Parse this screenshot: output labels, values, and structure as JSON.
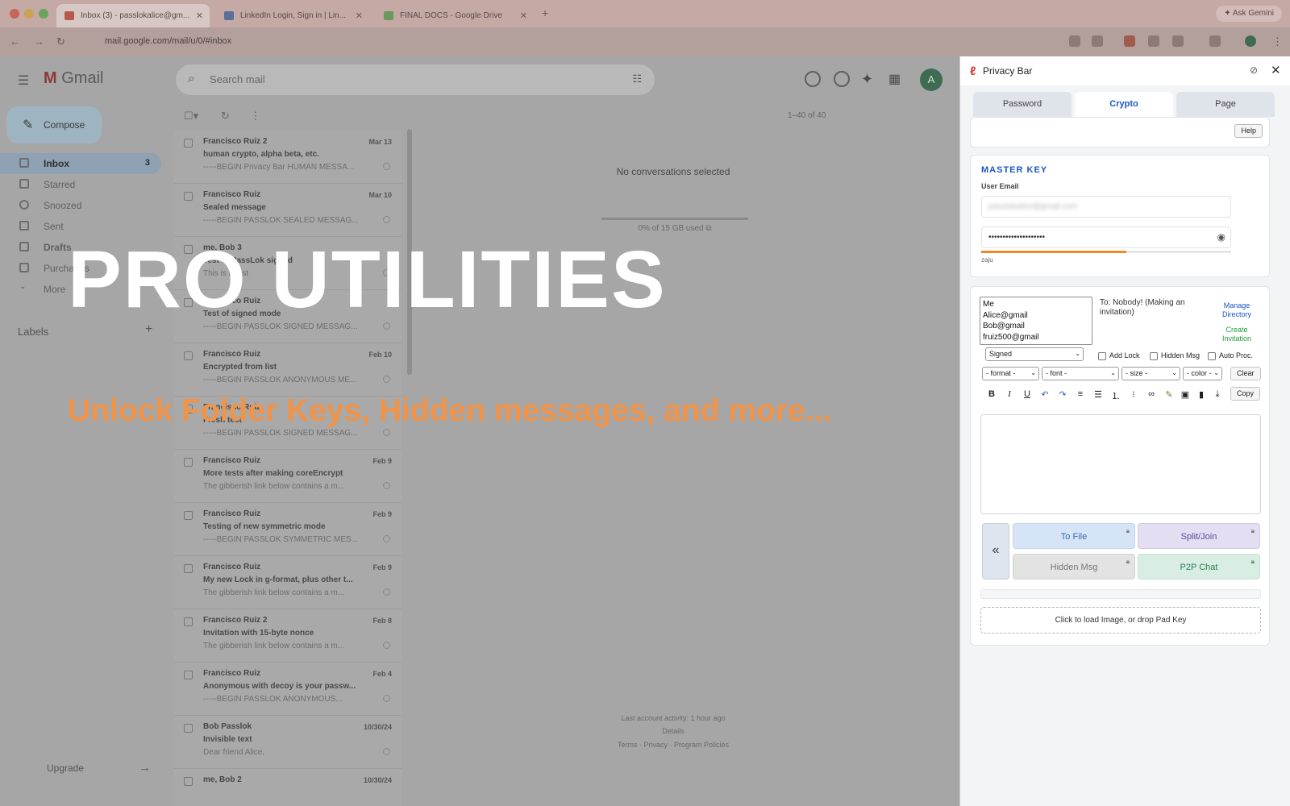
{
  "browser": {
    "tabs": [
      {
        "label": "Inbox (3) - passlokalice@gm...",
        "active": true,
        "favicon_color": "#b55a4a"
      },
      {
        "label": "LinkedIn Login, Sign in | Lin...",
        "active": false,
        "favicon_color": "#5a6f9a"
      },
      {
        "label": "FINAL DOCS - Google Drive",
        "active": false,
        "favicon_color": "#6a9a5a"
      }
    ],
    "ask_gemini": "Ask Gemini",
    "url": "mail.google.com/mail/u/0/#inbox"
  },
  "gmail": {
    "logo_text": "Gmail",
    "search_placeholder": "Search mail",
    "avatar_letter": "A",
    "compose_label": "Compose",
    "sidebar": [
      {
        "label": "Inbox",
        "count": "3",
        "active": true
      },
      {
        "label": "Starred",
        "count": "",
        "active": false
      },
      {
        "label": "Snoozed",
        "count": "",
        "active": false
      },
      {
        "label": "Sent",
        "count": "",
        "active": false
      },
      {
        "label": "Drafts",
        "count": "",
        "active": false
      },
      {
        "label": "Purchases",
        "count": "",
        "active": false
      },
      {
        "label": "More",
        "count": "",
        "active": false
      }
    ],
    "labels_heading": "Labels",
    "upgrade_label": "Upgrade",
    "pager_text": "1–40 of 40",
    "messages": [
      {
        "from": "Francisco Ruiz 2",
        "date": "Mar 13",
        "subject": "human crypto, alpha beta, etc.",
        "snippet": "-----BEGIN Privacy Bar HUMAN MESSA..."
      },
      {
        "from": "Francisco Ruiz",
        "date": "Mar 10",
        "subject": "Sealed message",
        "snippet": "-----BEGIN PASSLOK SEALED MESSAG..."
      },
      {
        "from": "me, Bob 3",
        "date": "",
        "subject": "Test of PassLok signed",
        "snippet": "This is a test"
      },
      {
        "from": "Francisco Ruiz",
        "date": "",
        "subject": "Test of signed mode",
        "snippet": "-----BEGIN PASSLOK SIGNED MESSAG..."
      },
      {
        "from": "Francisco Ruiz",
        "date": "Feb 10",
        "subject": "Encrypted from list",
        "snippet": "-----BEGIN PASSLOK ANONYMOUS ME..."
      },
      {
        "from": "Francisco Ruiz",
        "date": "",
        "subject": "Fresh test",
        "snippet": "-----BEGIN PASSLOK SIGNED MESSAG..."
      },
      {
        "from": "Francisco Ruiz",
        "date": "Feb 9",
        "subject": "More tests after making coreEncrypt",
        "snippet": "The gibberish link below contains a m..."
      },
      {
        "from": "Francisco Ruiz",
        "date": "Feb 9",
        "subject": "Testing of new symmetric mode",
        "snippet": "-----BEGIN PASSLOK SYMMETRIC MES..."
      },
      {
        "from": "Francisco Ruiz",
        "date": "Feb 9",
        "subject": "My new Lock in g-format, plus other t...",
        "snippet": "The gibberish link below contains a m..."
      },
      {
        "from": "Francisco Ruiz 2",
        "date": "Feb 8",
        "subject": "Invitation with 15-byte nonce",
        "snippet": "The gibberish link below contains a m..."
      },
      {
        "from": "Francisco Ruiz",
        "date": "Feb 4",
        "subject": "Anonymous with decoy is your passw...",
        "snippet": "-----BEGIN PASSLOK ANONYMOUS..."
      },
      {
        "from": "Bob Passlok",
        "date": "10/30/24",
        "subject": "Invisible text",
        "snippet": "Dear friend Alice,"
      },
      {
        "from": "me, Bob 2",
        "date": "10/30/24",
        "subject": "",
        "snippet": ""
      }
    ],
    "no_conversations": "No conversations selected",
    "storage_text": "0% of 15 GB used",
    "footer_activity": "Last account activity: 1 hour ago",
    "footer_details": "Details",
    "footer_links": "Terms · Privacy · Program Policies"
  },
  "overlay": {
    "title": "PRO UTILITIES",
    "subtitle": "Unlock Folder Keys, Hidden messages, and more..."
  },
  "privacy_bar": {
    "title": "Privacy Bar",
    "tabs": [
      {
        "label": "Password",
        "active": false
      },
      {
        "label": "Crypto",
        "active": true
      },
      {
        "label": "Page",
        "active": false
      }
    ],
    "help_label": "Help",
    "master_key": {
      "heading": "MASTER KEY",
      "email_label": "User Email",
      "email_value": "passlokalice@gmail.com",
      "password_value": "••••••••••••••••••••",
      "strength_pct": 58,
      "strength_text": "zaju"
    },
    "recipients": [
      "Me",
      "Alice@gmail",
      "Bob@gmail",
      "fruiz500@gmail"
    ],
    "to_text": "To: Nobody! (Making an invitation)",
    "manage_directory": "Manage Directory",
    "create_invitation": "Create Invitation",
    "mode_select": "Signed",
    "checkboxes": {
      "add_lock": "Add Lock",
      "hidden_msg": "Hidden Msg",
      "auto_proc": "Auto Proc."
    },
    "format_select": "- format -",
    "font_select": "- font -",
    "size_select": "- size -",
    "color_select": "- color -",
    "clear_label": "Clear",
    "copy_label": "Copy",
    "back_label": "«",
    "buttons": {
      "to_file": "To File",
      "split_join": "Split/Join",
      "hidden_msg": "Hidden Msg",
      "p2p_chat": "P2P Chat"
    },
    "drop_zone": "Click to load Image, or drop Pad Key"
  }
}
